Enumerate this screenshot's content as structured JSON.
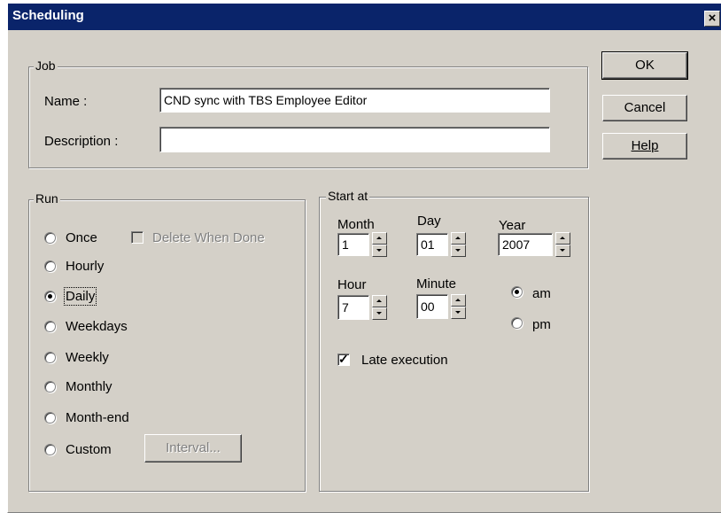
{
  "window": {
    "title": "Scheduling",
    "close_glyph": "×"
  },
  "buttons": {
    "ok": "OK",
    "cancel": "Cancel",
    "help": "Help",
    "interval": "Interval..."
  },
  "job": {
    "legend": "Job",
    "name_label": "Name :",
    "name_value": "CND sync with TBS Employee Editor",
    "description_label": "Description :",
    "description_value": ""
  },
  "run": {
    "legend": "Run",
    "selected": "Daily",
    "options": [
      "Once",
      "Hourly",
      "Daily",
      "Weekdays",
      "Weekly",
      "Monthly",
      "Month-end",
      "Custom"
    ],
    "delete_when_done_label": "Delete When Done",
    "delete_when_done_checked": false
  },
  "start": {
    "legend": "Start at",
    "month_label": "Month",
    "month_value": "1",
    "day_label": "Day",
    "day_value": "01",
    "year_label": "Year",
    "year_value": "2007",
    "hour_label": "Hour",
    "hour_value": "7",
    "minute_label": "Minute",
    "minute_value": "00",
    "am_label": "am",
    "pm_label": "pm",
    "ampm_selected": "am",
    "late_execution_label": "Late execution",
    "late_execution_checked": true
  }
}
